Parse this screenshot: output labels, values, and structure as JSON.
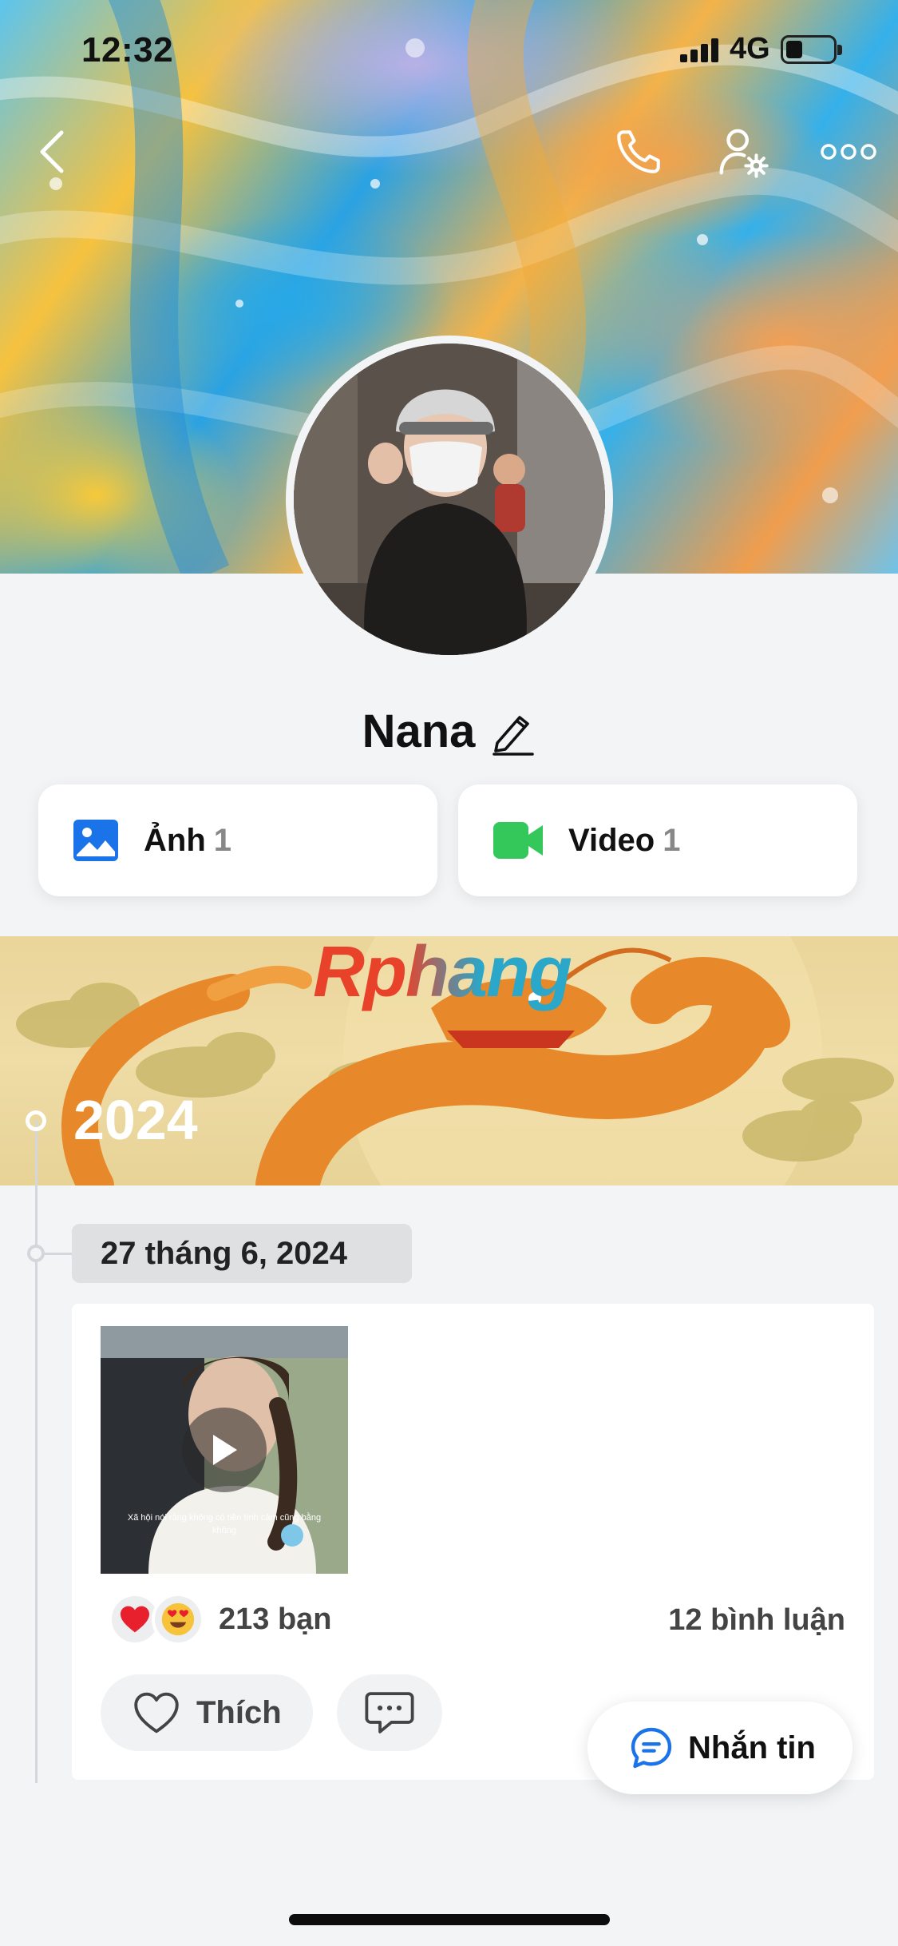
{
  "status_bar": {
    "time": "12:32",
    "network": "4G",
    "battery_level": 0.35
  },
  "colors": {
    "accent_blue": "#1a73e8",
    "video_green": "#34c759",
    "heart_red": "#e8202e",
    "background": "#f3f4f6"
  },
  "header": {
    "icons": [
      "back-icon",
      "phone-icon",
      "person-settings-icon",
      "more-icon"
    ]
  },
  "profile": {
    "name": "Nana"
  },
  "media": {
    "photos": {
      "label": "Ảnh",
      "count": "1"
    },
    "videos": {
      "label": "Video",
      "count": "1"
    }
  },
  "timeline": {
    "watermark": "Rphang",
    "year": "2024",
    "date": "27 tháng 6, 2024",
    "post": {
      "caption": "Xã hội nói rằng không có tiền tình cảm cũng bằng không",
      "reaction_count": "213 bạn",
      "comment_count": "12 bình luận",
      "like_label": "Thích"
    }
  },
  "floating_button": {
    "label": "Nhắn tin"
  }
}
